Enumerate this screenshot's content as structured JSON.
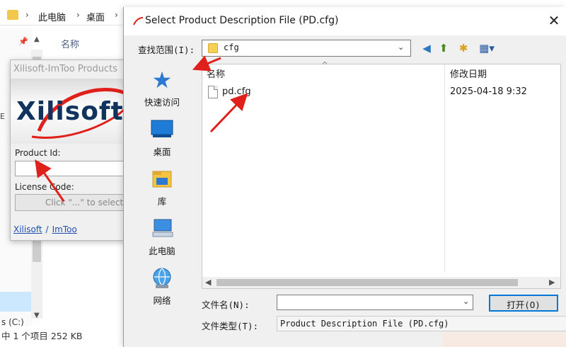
{
  "explorer": {
    "breadcrumb": [
      "此电脑",
      "桌面"
    ],
    "column_name": "名称",
    "drive_label": "s (C:)",
    "status": "中 1 个项目   252 KB",
    "side_label": "E"
  },
  "xilisoft_dialog": {
    "title": "Xilisoft-ImToo Products",
    "logo": "Xilisoft",
    "product_id_label": "Product Id:",
    "product_id_value": "",
    "license_code_label": "License Code:",
    "license_button_text": "Click \"...\" to select a",
    "link_xilisoft": "Xilisoft",
    "link_sep": "/",
    "link_imtoo": "ImToo"
  },
  "file_dialog": {
    "title": "Select Product Description File (PD.cfg)",
    "close_glyph": "✕",
    "look_in_label": "查找范围(I):",
    "look_in_value": "cfg",
    "places": [
      {
        "label": "快速访问",
        "icon": "quick-access-icon"
      },
      {
        "label": "桌面",
        "icon": "desktop-icon"
      },
      {
        "label": "库",
        "icon": "library-icon"
      },
      {
        "label": "此电脑",
        "icon": "this-pc-icon"
      },
      {
        "label": "网络",
        "icon": "network-icon"
      }
    ],
    "columns": {
      "name": "名称",
      "modified": "修改日期"
    },
    "files": [
      {
        "name": "pd.cfg",
        "modified": "2025-04-18 9:32"
      }
    ],
    "file_name_label": "文件名(N):",
    "file_name_value": "",
    "file_type_label": "文件类型(T):",
    "file_type_value": "Product Description File (PD.cfg)",
    "open_button": "打开(O)"
  },
  "colors": {
    "annotation_arrow": "#e0201b",
    "logo_text": "#10345e",
    "link": "#1e4fb0",
    "folder": "#f5d15a"
  }
}
